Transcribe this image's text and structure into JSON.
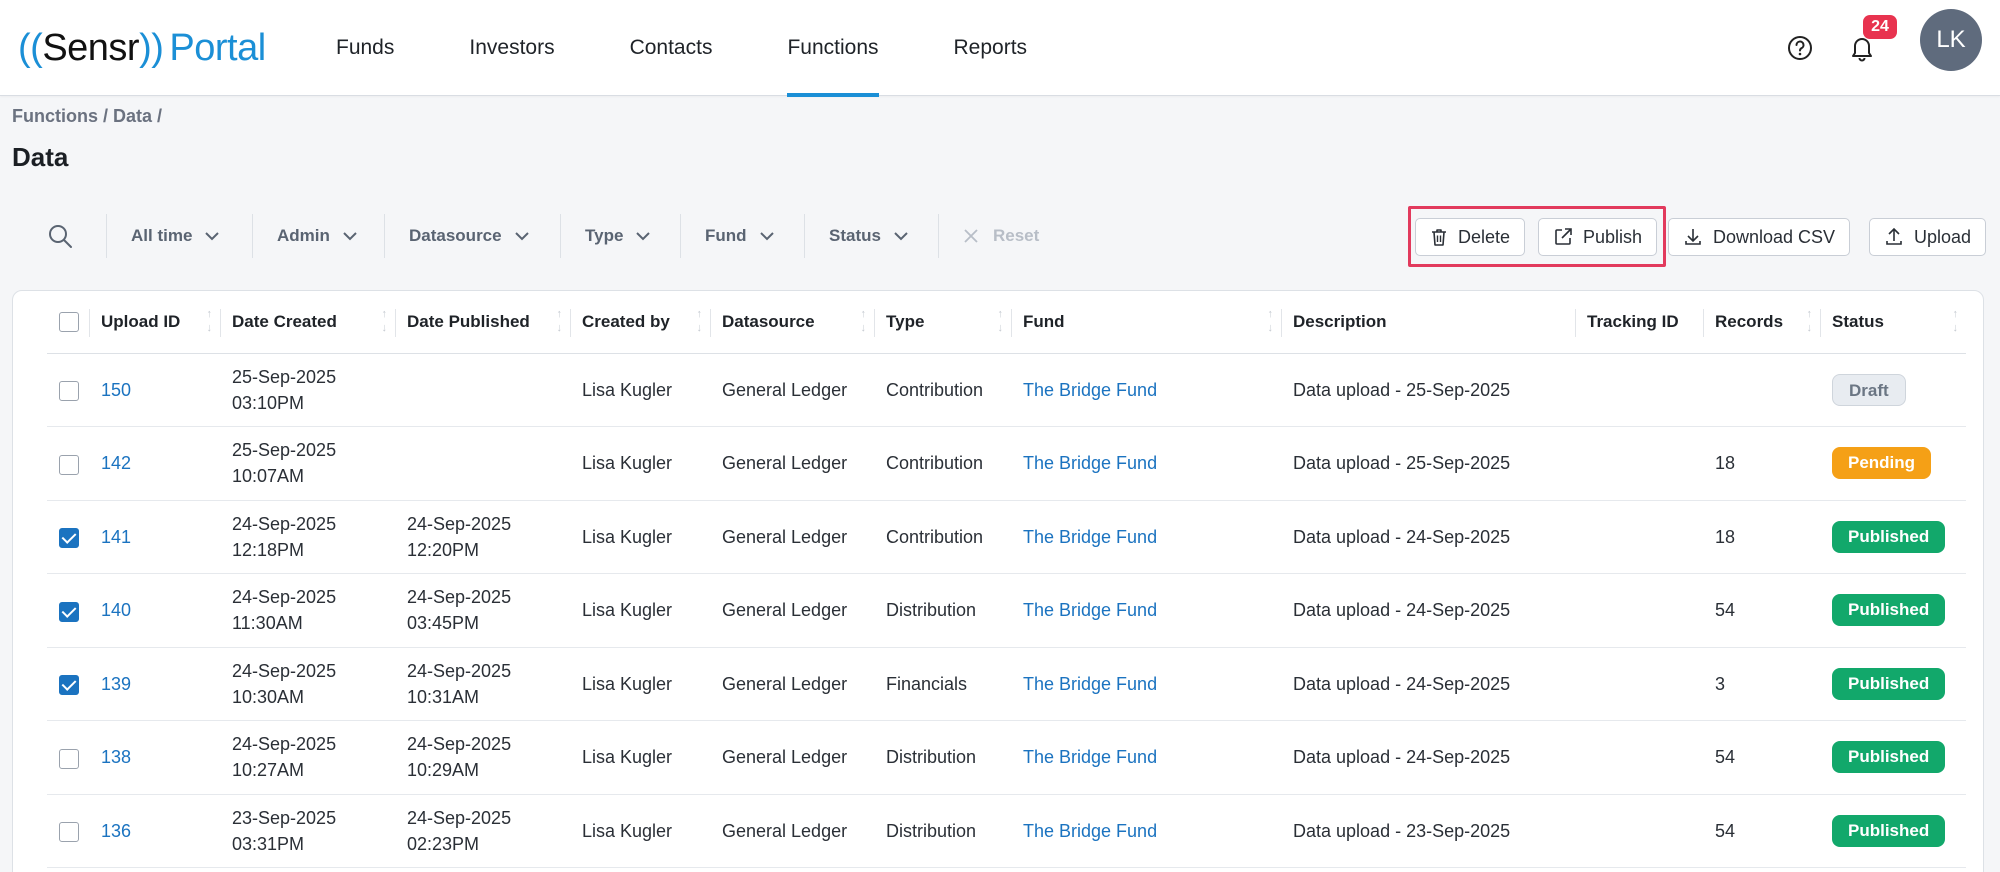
{
  "app": {
    "logo_wave": "((",
    "logo_brand": "Sensr",
    "logo_wave_close": "))",
    "logo_portal": "Portal",
    "notification_count": "24",
    "avatar_initials": "LK"
  },
  "nav": {
    "items": [
      {
        "label": "Funds"
      },
      {
        "label": "Investors"
      },
      {
        "label": "Contacts"
      },
      {
        "label": "Functions",
        "active": true
      },
      {
        "label": "Reports"
      }
    ]
  },
  "page": {
    "breadcrumb": "Functions / Data /",
    "title": "Data"
  },
  "filters": {
    "time": "All time",
    "admin": "Admin",
    "datasource": "Datasource",
    "type": "Type",
    "fund": "Fund",
    "status": "Status",
    "reset": "Reset"
  },
  "actions": {
    "delete": "Delete",
    "publish": "Publish",
    "download": "Download CSV",
    "upload": "Upload"
  },
  "table": {
    "headers": {
      "upload_id": "Upload ID",
      "date_created": "Date Created",
      "date_published": "Date Published",
      "created_by": "Created by",
      "datasource": "Datasource",
      "type": "Type",
      "fund": "Fund",
      "description": "Description",
      "tracking_id": "Tracking ID",
      "records": "Records",
      "status": "Status"
    },
    "rows": [
      {
        "checked": false,
        "id": "150",
        "created_date": "25-Sep-2025",
        "created_time": "03:10PM",
        "published_date": "",
        "published_time": "",
        "created_by": "Lisa Kugler",
        "datasource": "General Ledger",
        "type": "Contribution",
        "fund": "The Bridge Fund",
        "description": "Data upload - 25-Sep-2025",
        "tracking_id": "",
        "records": "",
        "status": "Draft",
        "status_kind": "draft"
      },
      {
        "checked": false,
        "id": "142",
        "created_date": "25-Sep-2025",
        "created_time": "10:07AM",
        "published_date": "",
        "published_time": "",
        "created_by": "Lisa Kugler",
        "datasource": "General Ledger",
        "type": "Contribution",
        "fund": "The Bridge Fund",
        "description": "Data upload - 25-Sep-2025",
        "tracking_id": "",
        "records": "18",
        "status": "Pending",
        "status_kind": "pending"
      },
      {
        "checked": true,
        "id": "141",
        "created_date": "24-Sep-2025",
        "created_time": "12:18PM",
        "published_date": "24-Sep-2025",
        "published_time": "12:20PM",
        "created_by": "Lisa Kugler",
        "datasource": "General Ledger",
        "type": "Contribution",
        "fund": "The Bridge Fund",
        "description": "Data upload - 24-Sep-2025",
        "tracking_id": "",
        "records": "18",
        "status": "Published",
        "status_kind": "published"
      },
      {
        "checked": true,
        "id": "140",
        "created_date": "24-Sep-2025",
        "created_time": "11:30AM",
        "published_date": "24-Sep-2025",
        "published_time": "03:45PM",
        "created_by": "Lisa Kugler",
        "datasource": "General Ledger",
        "type": "Distribution",
        "fund": "The Bridge Fund",
        "description": "Data upload - 24-Sep-2025",
        "tracking_id": "",
        "records": "54",
        "status": "Published",
        "status_kind": "published"
      },
      {
        "checked": true,
        "id": "139",
        "created_date": "24-Sep-2025",
        "created_time": "10:30AM",
        "published_date": "24-Sep-2025",
        "published_time": "10:31AM",
        "created_by": "Lisa Kugler",
        "datasource": "General Ledger",
        "type": "Financials",
        "fund": "The Bridge Fund",
        "description": "Data upload - 24-Sep-2025",
        "tracking_id": "",
        "records": "3",
        "status": "Published",
        "status_kind": "published"
      },
      {
        "checked": false,
        "id": "138",
        "created_date": "24-Sep-2025",
        "created_time": "10:27AM",
        "published_date": "24-Sep-2025",
        "published_time": "10:29AM",
        "created_by": "Lisa Kugler",
        "datasource": "General Ledger",
        "type": "Distribution",
        "fund": "The Bridge Fund",
        "description": "Data upload - 24-Sep-2025",
        "tracking_id": "",
        "records": "54",
        "status": "Published",
        "status_kind": "published"
      },
      {
        "checked": false,
        "id": "136",
        "created_date": "23-Sep-2025",
        "created_time": "03:31PM",
        "published_date": "24-Sep-2025",
        "published_time": "02:23PM",
        "created_by": "Lisa Kugler",
        "datasource": "General Ledger",
        "type": "Distribution",
        "fund": "The Bridge Fund",
        "description": "Data upload - 23-Sep-2025",
        "tracking_id": "",
        "records": "54",
        "status": "Published",
        "status_kind": "published"
      }
    ]
  },
  "colors": {
    "accent": "#1b8fd6",
    "link": "#1b73c0",
    "highlight": "#e23a5d",
    "published": "#12a86b",
    "pending": "#f5a016"
  }
}
